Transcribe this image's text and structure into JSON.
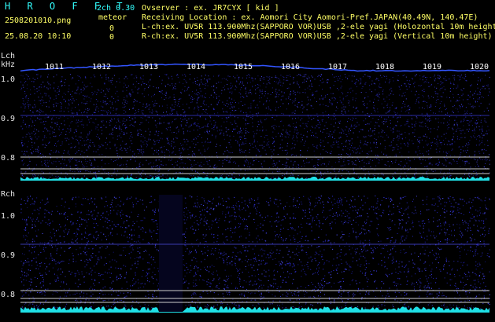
{
  "header": {
    "title": "H R O F F T",
    "channels": "2ch 0.30",
    "mode": "meteor",
    "filename": "2508201010.png",
    "datetime": "25.08.20 10:10",
    "count_l": "0",
    "count_r": "0",
    "observer_line": "Ovserver           : ex. JR7CYX [ kid ]",
    "location_line": "Receiving Location : ex. Aomori City Aomori-Pref.JAPAN(40.49N, 140.47E)",
    "lch_line": "L-ch:ex. UV5R 113.900Mhz(SAPPORO VOR)USB ,2-ele yagi (Holozontal 10m height)",
    "rch_line": "R-ch:ex. UV5R 113.900Mhz(SAPPORO VOR)USB ,2-ele yagi (Vertical 10m height)"
  },
  "lch": {
    "label": "Lch",
    "unit": "kHz",
    "freq_ticks": [
      "1.0",
      "0.9",
      "0.8"
    ]
  },
  "rch": {
    "label": "Rch",
    "freq_ticks": [
      "1.0",
      "0.9",
      "0.8"
    ]
  },
  "time_ticks": [
    "1011",
    "1012",
    "1013",
    "1014",
    "1015",
    "1016",
    "1017",
    "1018",
    "1019",
    "1020"
  ],
  "colors": {
    "background": "#000000",
    "noise": "#1a1a8c",
    "trace": "#3355ff",
    "level": "#33ffff",
    "header_text": "#ffff66"
  }
}
